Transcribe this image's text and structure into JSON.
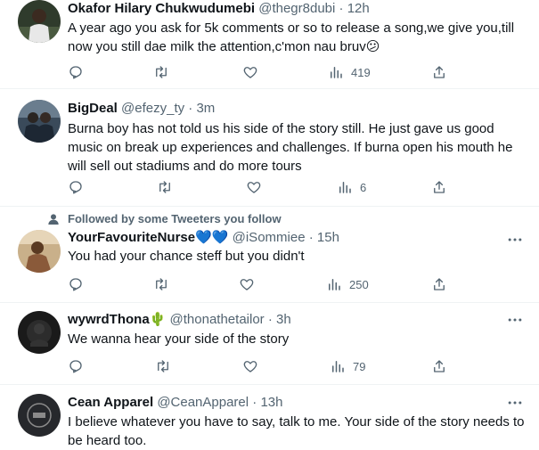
{
  "tweets": [
    {
      "name": "Okafor Hilary Chukwudumebi",
      "handle": "@thegr8dubi",
      "time": "12h",
      "text": "A year ago you ask for 5k comments or so to release a song,we give you,till now you still dae milk the attention,c'mon nau bruv😕",
      "views": "419",
      "social_context": ""
    },
    {
      "name": "BigDeal",
      "handle": "@efezy_ty",
      "time": "3m",
      "text": "Burna boy has not told us his side of the story still. He just gave us good music on break up experiences and challenges. If burna open his mouth he will sell out stadiums and do more tours",
      "views": "6",
      "social_context": ""
    },
    {
      "name": "YourFavouriteNurse💙💙",
      "handle": "@iSommiee",
      "time": "15h",
      "text": "You had your chance steff but you didn't",
      "views": "250",
      "social_context": "Followed by some Tweeters you follow"
    },
    {
      "name": "wywrdThona🌵",
      "handle": "@thonathetailor",
      "time": "3h",
      "text": "We wanna hear your side of the story",
      "views": "79",
      "social_context": ""
    },
    {
      "name": "Cean Apparel",
      "handle": "@CeanApparel",
      "time": "13h",
      "text": "I believe whatever you have to say, talk to me. Your side of the story needs to be heard too.",
      "views": "",
      "social_context": ""
    }
  ],
  "separator": "·",
  "colors": {
    "text": "#0f1419",
    "secondary": "#536471",
    "divider": "#eff3f4",
    "heart_blue": "#5aa7e6",
    "cactus": "#5aa83c"
  },
  "icons": [
    "reply-icon",
    "retweet-icon",
    "like-icon",
    "views-icon",
    "share-icon",
    "more-icon",
    "person-icon"
  ]
}
